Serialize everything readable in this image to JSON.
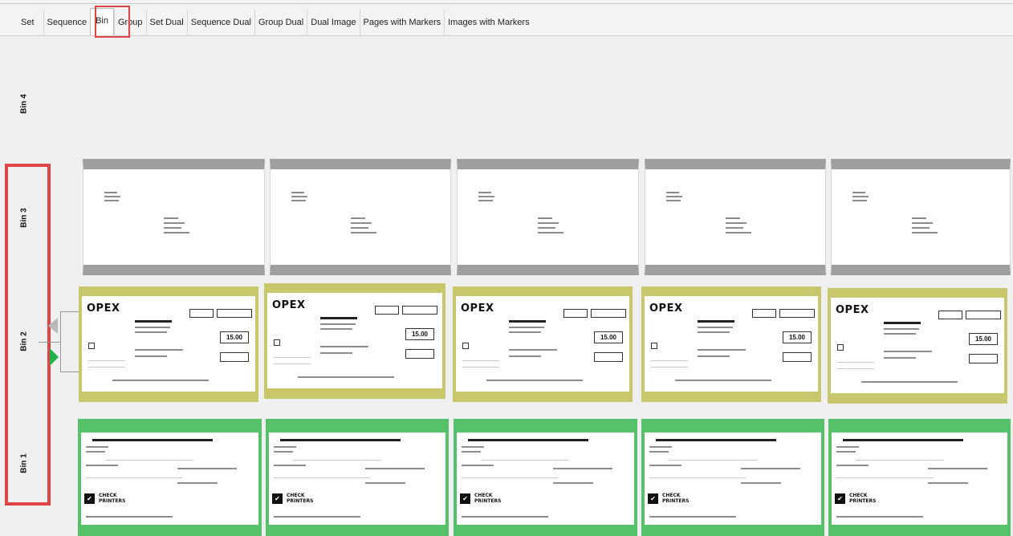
{
  "tabs": [
    {
      "label": "Set"
    },
    {
      "label": "Sequence"
    },
    {
      "label": "Bin",
      "active": true
    },
    {
      "label": "Group"
    },
    {
      "label": "Set Dual"
    },
    {
      "label": "Sequence Dual"
    },
    {
      "label": "Group Dual"
    },
    {
      "label": "Dual Image"
    },
    {
      "label": "Pages with Markers"
    },
    {
      "label": "Images with Markers"
    }
  ],
  "bins": [
    {
      "label": "Bin 4"
    },
    {
      "label": "Bin 3"
    },
    {
      "label": "Bin 2"
    },
    {
      "label": "Bin 1"
    }
  ],
  "documents": {
    "opex_logo": "OPEX",
    "opex_amount": "15.00",
    "check_icon": "✔",
    "check_logo_line1": "CHECK",
    "check_logo_line2": "PRINTERS"
  },
  "colors": {
    "highlight_red": "#e04545",
    "bin3_band": "#9f9f9f",
    "bin2_band": "#c9c76b",
    "bin1_band": "#55c26a",
    "marker_green": "#22b14c",
    "marker_grey": "#b9b9b9"
  },
  "icons": {
    "marker_previous": "triangle-left-grey",
    "marker_current": "triangle-right-green"
  }
}
